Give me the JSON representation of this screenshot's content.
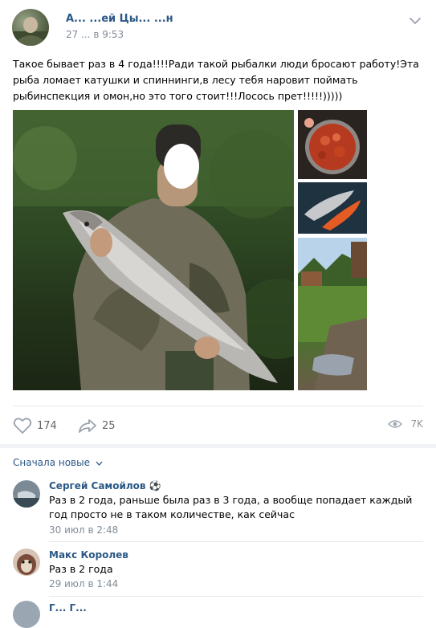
{
  "post": {
    "author": "А... ...ей Цы... ...н",
    "time": "27 ... в 9:53",
    "text": "Такое бывает раз в 4 года!!!!Ради такой рыбалки люди бросают работу!Эта рыба ломает катушки и спиннинги,в лесу тебя наровит поймать рыбинспекция и омон,но это того стоит!!!Лосось прет!!!!!)))))",
    "photos": [
      "photo",
      "photo",
      "photo",
      "photo"
    ]
  },
  "actions": {
    "likes": "174",
    "shares": "25",
    "views": "7K"
  },
  "comments_header": {
    "sort_label": "Сначала новые"
  },
  "comments": [
    {
      "name": "Сергей Самойлов",
      "emoji": "⚽",
      "text": "Раз в 2 года, раньше была раз в 3 года, а вообще попадает каждый год просто не в таком количестве, как сейчас",
      "date": "30 июл в 2:48"
    },
    {
      "name": "Макс Королев",
      "text": "Раз в 2 года",
      "date": "29 июл в 1:44"
    },
    {
      "name": "Г... Г..."
    }
  ],
  "colors": {
    "link": "#2a5885",
    "secondary": "#818c99",
    "divider": "#e7e8ec"
  }
}
